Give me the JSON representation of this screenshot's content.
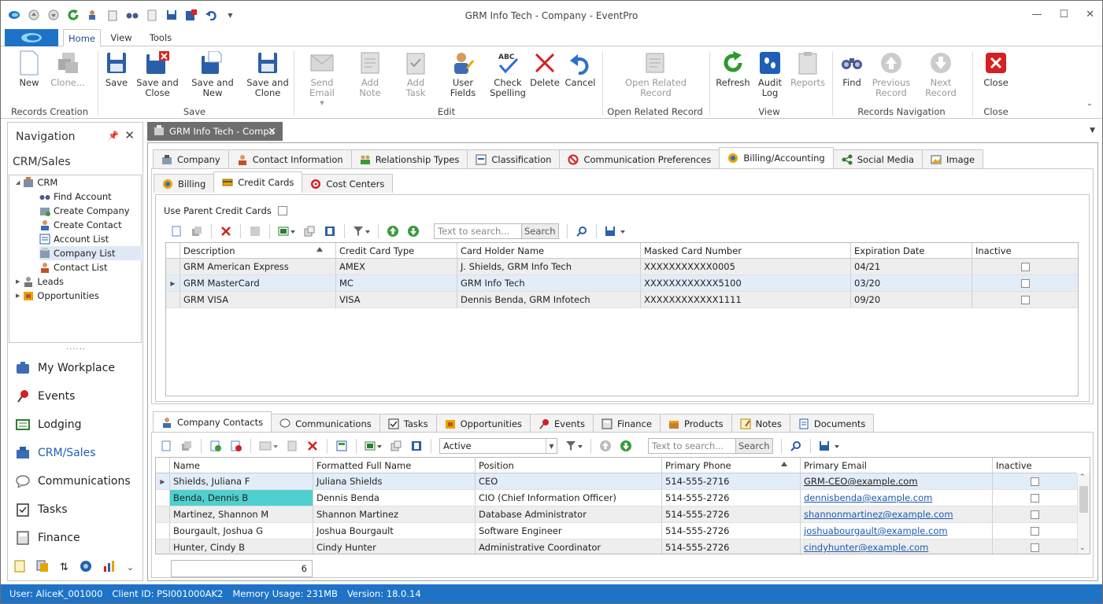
{
  "window": {
    "title": "GRM Info Tech - Company - EventPro",
    "controls": [
      "—",
      "☐",
      "✕"
    ]
  },
  "ribbon_tabs": [
    "Home",
    "View",
    "Tools"
  ],
  "ribbon": {
    "buttons": [
      {
        "l1": "New",
        "l2": ""
      },
      {
        "l1": "Clone...",
        "l2": ""
      },
      {
        "l1": "Save",
        "l2": ""
      },
      {
        "l1": "Save and",
        "l2": "Close"
      },
      {
        "l1": "Save and New",
        "l2": ""
      },
      {
        "l1": "Save and",
        "l2": "Clone"
      },
      {
        "l1": "Send Email",
        "l2": ""
      },
      {
        "l1": "Add Note",
        "l2": ""
      },
      {
        "l1": "Add Task",
        "l2": ""
      },
      {
        "l1": "User Fields",
        "l2": ""
      },
      {
        "l1": "Check",
        "l2": "Spelling"
      },
      {
        "l1": "Delete",
        "l2": ""
      },
      {
        "l1": "Cancel",
        "l2": ""
      },
      {
        "l1": "Open Related",
        "l2": "Record"
      },
      {
        "l1": "Refresh",
        "l2": ""
      },
      {
        "l1": "Audit",
        "l2": "Log"
      },
      {
        "l1": "Reports",
        "l2": ""
      },
      {
        "l1": "Find",
        "l2": ""
      },
      {
        "l1": "Previous",
        "l2": "Record"
      },
      {
        "l1": "Next Record",
        "l2": ""
      },
      {
        "l1": "Close",
        "l2": ""
      }
    ],
    "groups": [
      "Records Creation",
      "Save",
      "Edit",
      "Open Related Record",
      "View",
      "Records Navigation",
      "Close"
    ]
  },
  "nav": {
    "title": "Navigation",
    "section": "CRM/Sales",
    "tree": [
      "CRM",
      "Find Account",
      "Create Company",
      "Create Contact",
      "Account List",
      "Company List",
      "Contact List",
      "Leads",
      "Opportunities"
    ],
    "modules": [
      "My Workplace",
      "Events",
      "Lodging",
      "CRM/Sales",
      "Communications",
      "Tasks",
      "Finance"
    ]
  },
  "doc_tab": "GRM Info Tech - Compa",
  "main_tabs": [
    "Company",
    "Contact Information",
    "Relationship Types",
    "Classification",
    "Communication Preferences",
    "Billing/Accounting",
    "Social Media",
    "Image"
  ],
  "sub_tabs": [
    "Billing",
    "Credit Cards",
    "Cost Centers"
  ],
  "cc": {
    "use_parent_label": "Use Parent Credit Cards",
    "search_placeholder": "Text to search...",
    "search_button": "Search",
    "columns": [
      "Description",
      "Credit Card Type",
      "Card Holder Name",
      "Masked Card Number",
      "Expiration Date",
      "Inactive"
    ],
    "rows": [
      [
        "GRM American Express",
        "AMEX",
        "J. Shields, GRM Info Tech",
        "XXXXXXXXXXX0005",
        "04/21"
      ],
      [
        "GRM MasterCard",
        "MC",
        "GRM Info Tech",
        "XXXXXXXXXXXX5100",
        "03/20"
      ],
      [
        "GRM VISA",
        "VISA",
        "Dennis Benda, GRM Infotech",
        "XXXXXXXXXXXX1111",
        "09/20"
      ]
    ]
  },
  "bottom_tabs": [
    "Company Contacts",
    "Communications",
    "Tasks",
    "Opportunities",
    "Events",
    "Finance",
    "Products",
    "Notes",
    "Documents"
  ],
  "contacts": {
    "filter_value": "Active",
    "search_placeholder": "Text to search...",
    "search_button": "Search",
    "columns": [
      "Name",
      "Formatted Full Name",
      "Position",
      "Primary Phone",
      "Primary Email",
      "Inactive"
    ],
    "rows": [
      [
        "Shields, Juliana F",
        "Juliana Shields",
        "CEO",
        "514-555-2716",
        "GRM-CEO@example.com"
      ],
      [
        "Benda, Dennis B",
        "Dennis Benda",
        "CIO (Chief Information Officer)",
        "514-555-2726",
        "dennisbenda@example.com"
      ],
      [
        "Martinez, Shannon M",
        "Shannon Martinez",
        "Database Administrator",
        "514-555-2726",
        "shannonmartinez@example.com"
      ],
      [
        "Bourgault, Joshua G",
        "Joshua Bourgault",
        "Software Engineer",
        "514-555-2726",
        "joshuabourgault@example.com"
      ],
      [
        "Hunter, Cindy B",
        "Cindy Hunter",
        "Administrative Coordinator",
        "514-555-2726",
        "cindyhunter@example.com"
      ]
    ],
    "count": "6"
  },
  "status": {
    "user": "User: AliceK_001000",
    "client": "Client ID: PSI001000AK2",
    "memory": "Memory Usage: 231MB",
    "version": "Version: 18.0.14"
  },
  "colors": {
    "accent": "#1e73c7",
    "highlight_cell": "#4fd0d0"
  }
}
